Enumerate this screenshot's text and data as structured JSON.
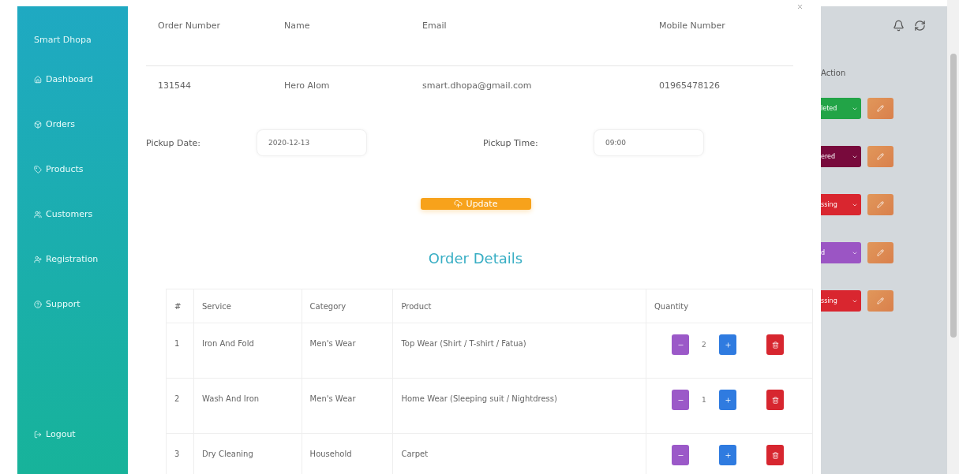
{
  "sidebar": {
    "brand": "Smart Dhopa",
    "items": [
      {
        "label": "Dashboard"
      },
      {
        "label": "Orders"
      },
      {
        "label": "Products"
      },
      {
        "label": "Customers"
      },
      {
        "label": "Registration"
      },
      {
        "label": "Support"
      }
    ],
    "logout": "Logout"
  },
  "modal": {
    "customer_table": {
      "columns": [
        "Order Number",
        "Name",
        "Email",
        "Mobile Number"
      ],
      "row": [
        "131544",
        "Hero Alom",
        "smart.dhopa@gmail.com",
        "01965478126"
      ]
    },
    "pickup_date": {
      "label": "Pickup Date:",
      "value": "2020-12-13"
    },
    "pickup_time": {
      "label": "Pickup Time:",
      "value": "09:00"
    },
    "update_button": "Update",
    "details_title": "Order Details",
    "details_table": {
      "columns": [
        "#",
        "Service",
        "Category",
        "Product",
        "Quantity"
      ],
      "rows": [
        {
          "cells": [
            "1",
            "Iron And Fold",
            "Men's Wear",
            "Top Wear (Shirt / T-shirt / Fatua)"
          ],
          "quantity": "2"
        },
        {
          "cells": [
            "2",
            "Wash And Iron",
            "Men's Wear",
            "Home Wear (Sleeping suit / Nightdress)"
          ],
          "quantity": "1"
        },
        {
          "cells": [
            "3",
            "Dry Cleaning",
            "Household",
            "Carpet"
          ],
          "quantity": ""
        }
      ]
    }
  },
  "background": {
    "action_header": "Action",
    "statuses": [
      {
        "label": "leted",
        "color": "#22a447"
      },
      {
        "label": "ered",
        "color": "#780a3c"
      },
      {
        "label": "ssing",
        "color": "#d9262f"
      },
      {
        "label": "d",
        "color": "#9b55c4"
      },
      {
        "label": "ssing",
        "color": "#d9262f"
      }
    ]
  }
}
